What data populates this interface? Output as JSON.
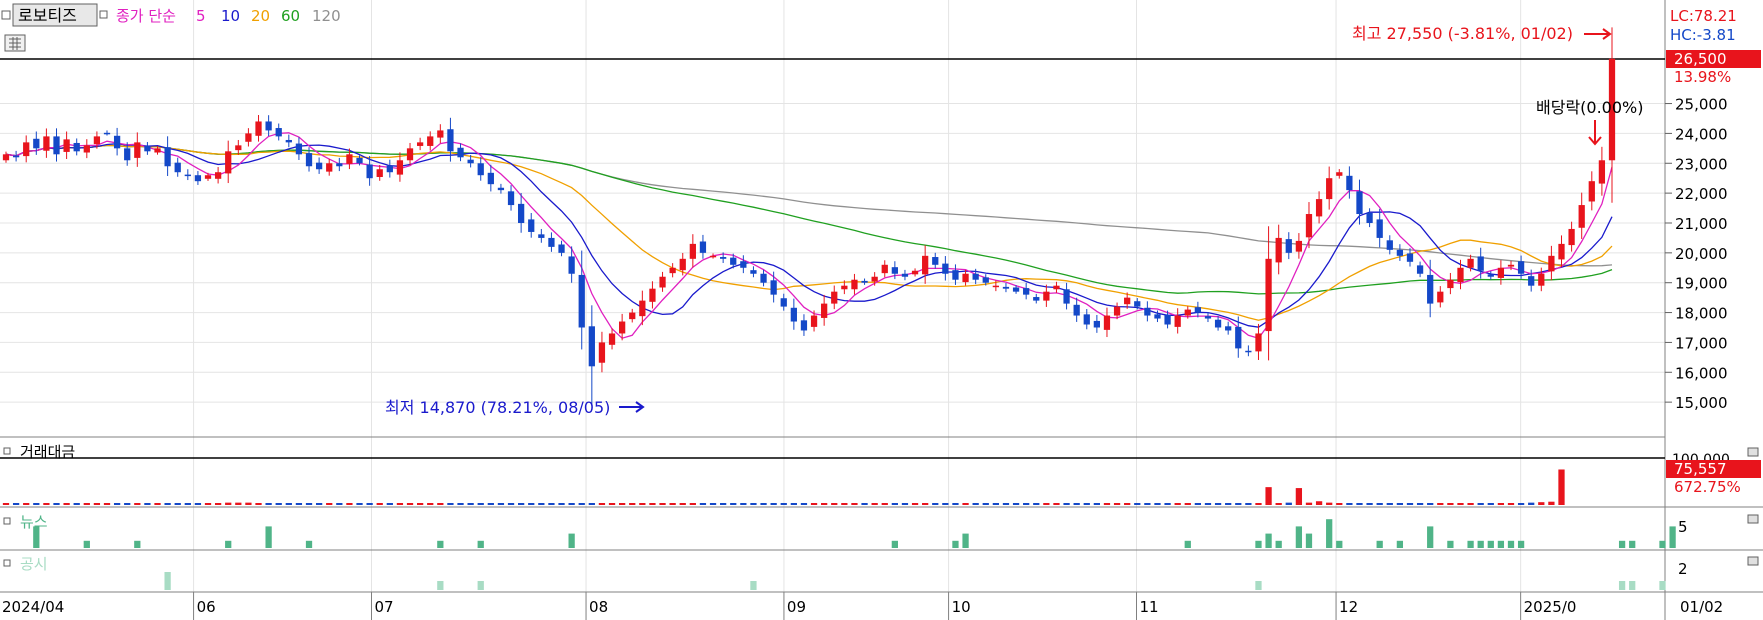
{
  "toolbar": {
    "stock_name": "로보티즈",
    "ma_label": "종가 단순",
    "ma_periods": [
      "5",
      "10",
      "20",
      "60",
      "120"
    ],
    "ma_colors": [
      "#e020c0",
      "#1a1acc",
      "#f0a000",
      "#20a020",
      "#909090"
    ]
  },
  "indicators": {
    "lc": "LC:78.21",
    "hc": "HC:-3.81",
    "last_price": "26,500",
    "change_pct": "13.98%",
    "high_annotation": "최고 27,550 (-3.81%, 01/02)",
    "low_annotation": "최저 14,870 (78.21%, 08/05)",
    "dividend_annotation": "배당락(0.00%)"
  },
  "volume_panel": {
    "title": "거래대금",
    "axis_label": "100,000",
    "last_value": "75,557",
    "change_pct": "672.75%"
  },
  "news_panel": {
    "title": "뉴스",
    "axis_label": "5"
  },
  "disclosure_panel": {
    "title": "공시",
    "axis_label": "2"
  },
  "colors": {
    "up": "#e8141c",
    "down": "#1448c8",
    "news_bar": "#50b488",
    "disclosure_bar": "#a8dcc4",
    "label_bg": "#e8141c"
  },
  "chart_data": {
    "type": "candlestick",
    "ylim": [
      14000,
      28200
    ],
    "y_ticks": [
      "25,000",
      "24,000",
      "23,000",
      "22,000",
      "21,000",
      "20,000",
      "19,000",
      "18,000",
      "17,000",
      "16,000",
      "15,000"
    ],
    "x_ticks": [
      "2024/04",
      "06",
      "07",
      "08",
      "09",
      "10",
      "11",
      "12",
      "2025/0",
      "01/02"
    ],
    "close_series": [
      23300,
      23200,
      23700,
      23500,
      23900,
      23300,
      23800,
      23400,
      23600,
      23900,
      24000,
      23500,
      23100,
      23700,
      23400,
      23500,
      22900,
      22700,
      22600,
      22400,
      22600,
      22700,
      23400,
      23600,
      24000,
      24400,
      24100,
      23900,
      23700,
      23300,
      22900,
      22800,
      23000,
      22900,
      23300,
      23000,
      22500,
      22800,
      22700,
      23100,
      23500,
      23700,
      23900,
      24100,
      23400,
      23200,
      23000,
      22600,
      22300,
      22100,
      21600,
      21000,
      20700,
      20500,
      20200,
      20000,
      19300,
      17500,
      16200,
      17000,
      17300,
      17700,
      18000,
      18400,
      18800,
      19200,
      19500,
      19800,
      20300,
      20000,
      19900,
      19800,
      19600,
      19500,
      19300,
      19000,
      18600,
      18200,
      17700,
      17400,
      17900,
      18300,
      18700,
      18900,
      19100,
      19000,
      19200,
      19600,
      19300,
      19200,
      19400,
      19900,
      19600,
      19300,
      19100,
      19300,
      19100,
      19000,
      18900,
      18800,
      18700,
      18600,
      18400,
      18700,
      18900,
      18300,
      17900,
      17600,
      17500,
      17900,
      18200,
      18500,
      18200,
      17900,
      17800,
      17600,
      17900,
      18100,
      18000,
      17800,
      17500,
      17400,
      16800,
      16700,
      17300,
      19800,
      20500,
      20000,
      20400,
      21300,
      21800,
      22500,
      22700,
      22100,
      21300,
      21000,
      20500,
      20100,
      19900,
      19700,
      19300,
      18300,
      18700,
      19100,
      19500,
      19800,
      19400,
      19200,
      19500,
      19600,
      19300,
      18900,
      19300,
      19900,
      20300,
      20800,
      21600,
      22400,
      23100,
      26500
    ],
    "volume_series": [
      3,
      4,
      4,
      3,
      4,
      3,
      3,
      4,
      3,
      3,
      3,
      4,
      3,
      3,
      3,
      3,
      3,
      4,
      3,
      3,
      3,
      3,
      5,
      5,
      5,
      4,
      4,
      3,
      3,
      3,
      3,
      3,
      3,
      3,
      4,
      3,
      3,
      3,
      3,
      3,
      3,
      3,
      3,
      3,
      3,
      3,
      3,
      3,
      3,
      3,
      3,
      3,
      3,
      3,
      3,
      3,
      3,
      4,
      4,
      3,
      3,
      3,
      3,
      3,
      3,
      3,
      3,
      3,
      3,
      3,
      3,
      3,
      3,
      3,
      3,
      3,
      3,
      3,
      3,
      3,
      3,
      3,
      3,
      3,
      3,
      3,
      3,
      3,
      3,
      3,
      3,
      3,
      3,
      3,
      3,
      3,
      3,
      3,
      3,
      3,
      3,
      3,
      3,
      3,
      3,
      3,
      3,
      3,
      3,
      3,
      3,
      3,
      3,
      3,
      3,
      3,
      3,
      3,
      3,
      3,
      3,
      3,
      3,
      3,
      3,
      38,
      4,
      5,
      36,
      5,
      8,
      5,
      4,
      4,
      3,
      3,
      3,
      3,
      3,
      3,
      3,
      3,
      3,
      3,
      3,
      3,
      3,
      3,
      3,
      4,
      4,
      5,
      6,
      7,
      75.557
    ],
    "news_series": [
      0,
      0,
      0,
      3,
      0,
      0,
      0,
      0,
      1,
      0,
      0,
      0,
      0,
      1,
      0,
      0,
      0,
      0,
      0,
      0,
      0,
      0,
      1,
      0,
      0,
      0,
      3,
      0,
      0,
      0,
      1,
      0,
      0,
      0,
      0,
      0,
      0,
      0,
      0,
      0,
      0,
      0,
      0,
      1,
      0,
      0,
      0,
      1,
      0,
      0,
      0,
      0,
      0,
      0,
      0,
      0,
      2,
      0,
      0,
      0,
      0,
      0,
      0,
      0,
      0,
      0,
      0,
      0,
      0,
      0,
      0,
      0,
      0,
      0,
      0,
      0,
      0,
      0,
      0,
      0,
      0,
      0,
      0,
      0,
      0,
      0,
      0,
      0,
      1,
      0,
      0,
      0,
      0,
      0,
      1,
      2,
      0,
      0,
      0,
      0,
      0,
      0,
      0,
      0,
      0,
      0,
      0,
      0,
      0,
      0,
      0,
      0,
      0,
      0,
      0,
      0,
      0,
      1,
      0,
      0,
      0,
      0,
      0,
      0,
      1,
      2,
      1,
      0,
      3,
      2,
      0,
      4,
      1,
      0,
      0,
      0,
      1,
      0,
      1,
      0,
      0,
      3,
      0,
      1,
      0,
      1,
      1,
      1,
      1,
      1,
      1,
      0,
      0,
      0,
      0,
      0,
      0,
      0,
      0,
      0,
      1,
      1,
      0,
      0,
      1,
      3
    ],
    "disclosure_series": [
      0,
      0,
      0,
      0,
      0,
      0,
      0,
      0,
      0,
      0,
      0,
      0,
      0,
      0,
      0,
      0,
      2,
      0,
      0,
      0,
      0,
      0,
      0,
      0,
      0,
      0,
      0,
      0,
      0,
      0,
      0,
      0,
      0,
      0,
      0,
      0,
      0,
      0,
      0,
      0,
      0,
      0,
      0,
      1,
      0,
      0,
      0,
      1,
      0,
      0,
      0,
      0,
      0,
      0,
      0,
      0,
      0,
      0,
      0,
      0,
      0,
      0,
      0,
      0,
      0,
      0,
      0,
      0,
      0,
      0,
      0,
      0,
      0,
      0,
      1,
      0,
      0,
      0,
      0,
      0,
      0,
      0,
      0,
      0,
      0,
      0,
      0,
      0,
      0,
      0,
      0,
      0,
      0,
      0,
      0,
      0,
      0,
      0,
      0,
      0,
      0,
      0,
      0,
      0,
      0,
      0,
      0,
      0,
      0,
      0,
      0,
      0,
      0,
      0,
      0,
      0,
      0,
      0,
      0,
      0,
      0,
      0,
      0,
      0,
      1,
      0,
      0,
      0,
      0,
      0,
      0,
      0,
      0,
      0,
      0,
      0,
      0,
      0,
      0,
      0,
      0,
      0,
      0,
      0,
      0,
      0,
      0,
      0,
      0,
      0,
      0,
      0,
      0,
      0,
      0,
      0,
      0,
      0,
      0,
      0,
      1,
      1,
      0,
      0,
      1,
      0
    ]
  }
}
